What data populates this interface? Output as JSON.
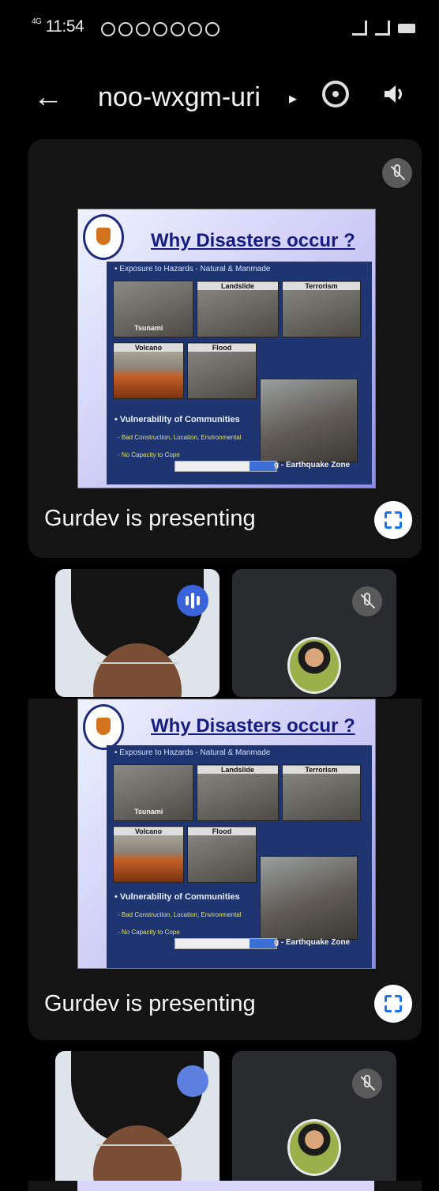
{
  "status_bar": {
    "time": "11:54",
    "network": "4G"
  },
  "call": {
    "meeting_code": "noo-wxgm-uri"
  },
  "presentation": {
    "presenter_text": "Gurdev is presenting",
    "slide": {
      "title": "Why Disasters occur ?",
      "bullet_exposure": "• Exposure to Hazards - Natural & Manmade",
      "photos": [
        "Tsunami",
        "Landslide",
        "Terrorism",
        "Volcano",
        "Flood"
      ],
      "bullet_vulnerability": "• Vulnerability of Communities",
      "sub_point_1": "- Bad Construction, Location, Environmental",
      "sub_point_2": "- No Capacity to Cope",
      "photo_caption": "g - Earthquake Zone"
    }
  },
  "icons": {
    "back": "back-arrow-icon",
    "more": "chevron-right-icon",
    "camera_flip": "switch-camera-icon",
    "audio": "speaker-icon",
    "mic_off": "mic-off-icon",
    "fullscreen": "fullscreen-icon",
    "speaking": "speaking-indicator-icon"
  }
}
